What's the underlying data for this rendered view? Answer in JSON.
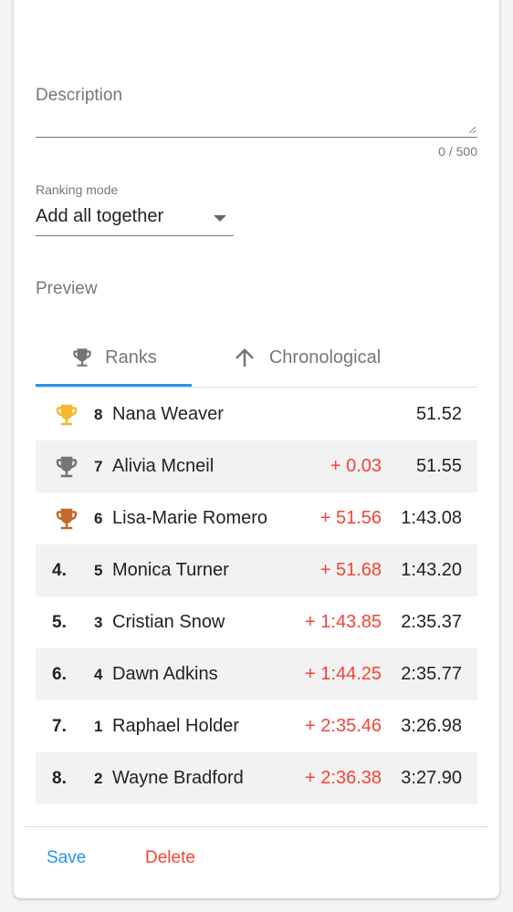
{
  "form": {
    "description": {
      "label": "Description",
      "value": "",
      "counter": "0 / 500"
    },
    "ranking_mode": {
      "label": "Ranking mode",
      "value": "Add all together"
    }
  },
  "preview": {
    "label": "Preview",
    "tabs": [
      {
        "label": "Ranks",
        "icon": "trophy-icon",
        "active": true
      },
      {
        "label": "Chronological",
        "icon": "arrow-up-icon",
        "active": false
      }
    ],
    "rows": [
      {
        "position": "",
        "trophy": "gold",
        "number": "8",
        "name": "Nana Weaver",
        "diff": "",
        "time": "51.52"
      },
      {
        "position": "",
        "trophy": "silver",
        "number": "7",
        "name": "Alivia Mcneil",
        "diff": "+ 0.03",
        "time": "51.55"
      },
      {
        "position": "",
        "trophy": "bronze",
        "number": "6",
        "name": "Lisa-Marie Romero",
        "diff": "+ 51.56",
        "time": "1:43.08"
      },
      {
        "position": "4.",
        "trophy": "",
        "number": "5",
        "name": "Monica Turner",
        "diff": "+ 51.68",
        "time": "1:43.20"
      },
      {
        "position": "5.",
        "trophy": "",
        "number": "3",
        "name": "Cristian Snow",
        "diff": "+ 1:43.85",
        "time": "2:35.37"
      },
      {
        "position": "6.",
        "trophy": "",
        "number": "4",
        "name": "Dawn Adkins",
        "diff": "+ 1:44.25",
        "time": "2:35.77"
      },
      {
        "position": "7.",
        "trophy": "",
        "number": "1",
        "name": "Raphael Holder",
        "diff": "+ 2:35.46",
        "time": "3:26.98"
      },
      {
        "position": "8.",
        "trophy": "",
        "number": "2",
        "name": "Wayne Bradford",
        "diff": "+ 2:36.38",
        "time": "3:27.90"
      }
    ]
  },
  "actions": {
    "save_label": "Save",
    "delete_label": "Delete"
  },
  "colors": {
    "accent": "#2196f3",
    "danger": "#f44336",
    "gold": "#f5b82e",
    "silver": "#757575",
    "bronze": "#c06a2b"
  }
}
